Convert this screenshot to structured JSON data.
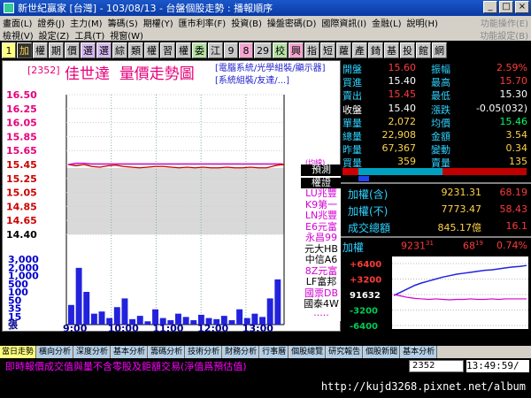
{
  "window": {
    "title": "新世紀贏家 [台灣] - 103/08/13 - 台盤個股走勢 : 播報順序",
    "min": "_",
    "max": "□",
    "close": "×"
  },
  "menu1": [
    "畫面(L)",
    "證券(J)",
    "主力(M)",
    "籌碼(S)",
    "期權(Y)",
    "匯市利率(F)",
    "投資(B)",
    "操盤密碼(D)",
    "國際資訊(I)",
    "金融(L)",
    "說明(H)",
    "功能操作(E)"
  ],
  "menu2": [
    "檢視(V)",
    "設定(Z)",
    "工具(T)",
    "視窗(W)",
    "功能設定(B)"
  ],
  "tabs": [
    "1",
    "加",
    "權",
    "期",
    "價",
    "選",
    "選",
    "綜",
    "類",
    "權",
    "習",
    "權",
    "委",
    "江",
    "9",
    "8",
    "29",
    "校",
    "興",
    "指",
    "短",
    "蘿",
    "產",
    "錡",
    "基",
    "投",
    "館",
    "網"
  ],
  "stock": {
    "code": "[2352]",
    "name": "佳世達",
    "chart_title": "量價走勢圖",
    "categories": [
      "[電腦系統/光學組裝/顯示器]",
      "[系統組裝/友達/...]"
    ]
  },
  "axis": {
    "price_labels": [
      "16.50",
      "16.25",
      "16.05",
      "15.85",
      "15.65",
      "15.45",
      "15.25",
      "15.05",
      "14.85",
      "14.65",
      "14.40"
    ],
    "volume_labels": [
      "3,000",
      "2,000",
      "1,000",
      "500",
      "100",
      "50",
      "35",
      "15",
      "張"
    ],
    "time_labels": [
      "9:00",
      "10:00",
      "11:00",
      "12:00",
      "13:00"
    ],
    "avg_label": "(均線)"
  },
  "legend": {
    "ticker": "預測",
    "header": "權證",
    "items": [
      {
        "text": "LU兆豐",
        "color": "#d400d4"
      },
      {
        "text": "K9第一",
        "color": "#d400d4"
      },
      {
        "text": "LN兆豐",
        "color": "#d400d4"
      },
      {
        "text": "E6元富",
        "color": "#d400d4"
      },
      {
        "text": "永昌99",
        "color": "#d400d4"
      },
      {
        "text": "元大HB",
        "color": "#000000"
      },
      {
        "text": "中信A6",
        "color": "#000000"
      },
      {
        "text": "8Z元富",
        "color": "#d400d4"
      },
      {
        "text": "LF富邦",
        "color": "#000000"
      },
      {
        "text": "國票DB",
        "color": "#d400d4"
      },
      {
        "text": "國泰4W",
        "color": "#000000"
      },
      {
        "text": "·····",
        "color": "#d400d4"
      }
    ]
  },
  "quote": {
    "left": [
      {
        "label": "開盤",
        "value": "15.60",
        "lc": "#2fd2ff",
        "vc": "#ff3b3b"
      },
      {
        "label": "買進",
        "value": "15.40",
        "lc": "#2fd2ff",
        "vc": "#ffffff"
      },
      {
        "label": "賣出",
        "value": "15.45",
        "lc": "#2fd2ff",
        "vc": "#ff3b3b"
      },
      {
        "label": "收盤",
        "value": "15.40",
        "lc": "#ffffff",
        "vc": "#ffffff"
      },
      {
        "label": "單量",
        "value": "2,072",
        "lc": "#2fd2ff",
        "vc": "#ffd24a"
      },
      {
        "label": "總量",
        "value": "22,908",
        "lc": "#2fd2ff",
        "vc": "#ffd24a"
      },
      {
        "label": "昨量",
        "value": "67,367",
        "lc": "#2fd2ff",
        "vc": "#ffd24a"
      },
      {
        "label": "買量",
        "value": "359",
        "lc": "#2fd2ff",
        "vc": "#ffd24a"
      }
    ],
    "right": [
      {
        "label": "振幅",
        "value": "2.59%",
        "lc": "#2fd2ff",
        "vc": "#ff3b3b"
      },
      {
        "label": "最高",
        "value": "15.70",
        "lc": "#2fd2ff",
        "vc": "#ff3b3b"
      },
      {
        "label": "最低",
        "value": "15.30",
        "lc": "#2fd2ff",
        "vc": "#ffffff"
      },
      {
        "label": "漲跌",
        "value": "-0.05(032)",
        "lc": "#2fd2ff",
        "vc": "#ffffff"
      },
      {
        "label": "均價",
        "value": "15.46",
        "lc": "#2fd2ff",
        "vc": "#00ff66"
      },
      {
        "label": "金額",
        "value": "3.54",
        "lc": "#2fd2ff",
        "vc": "#ffd24a"
      },
      {
        "label": "變動",
        "value": "0.34",
        "lc": "#2fd2ff",
        "vc": "#ffd24a"
      },
      {
        "label": "賣量",
        "value": "135",
        "lc": "#2fd2ff",
        "vc": "#ffd24a"
      }
    ]
  },
  "index": {
    "rows": [
      {
        "label": "加權(含)",
        "value": "9231.31",
        "change": "68.19"
      },
      {
        "label": "加權(不)",
        "value": "7773.47",
        "change": "58.43"
      },
      {
        "label": "成交總額",
        "value": "845.17億",
        "change": "16.1"
      }
    ],
    "mini": {
      "label": "加權",
      "value": "9231",
      "value_sup": "31",
      "change": "68",
      "change_sup": "19",
      "pct": "0.74%",
      "y_labels": [
        "+6400",
        "+3200",
        "91632",
        "-3200",
        "-6400"
      ]
    }
  },
  "bottom_tabs": [
    "當日走勢",
    "橫向分析",
    "深度分析",
    "基本分析",
    "籌碼分析",
    "技術分析",
    "財務分析",
    "行事曆",
    "個股總覽",
    "研究報告",
    "個股新聞",
    "基本分析"
  ],
  "status": {
    "text": "即時報價成交值與量不含零股及鉅額交易(淨值爲預估值)",
    "code_input": "2352",
    "clock": "13:49:59/"
  },
  "footer_url": "http://kujd3268.pixnet.net/album",
  "chart_data": {
    "type": "line",
    "title": "量價走勢圖",
    "x": [
      "9:00",
      "10:00",
      "11:00",
      "12:00",
      "13:00"
    ],
    "ylim": [
      14.4,
      16.5
    ],
    "series": [
      {
        "name": "price",
        "color": "#cc0000",
        "values": [
          15.45,
          15.43,
          15.45,
          15.42,
          15.41,
          15.43,
          15.44,
          15.42,
          15.41,
          15.4,
          15.41,
          15.42,
          15.42,
          15.41,
          15.4,
          15.41,
          15.4,
          15.41,
          15.4,
          15.4,
          15.41,
          15.4,
          15.4,
          15.41,
          15.4,
          15.4,
          15.43,
          15.45
        ]
      },
      {
        "name": "average",
        "color": "#d400d4",
        "values": [
          15.45,
          15.47,
          15.47,
          15.46,
          15.46,
          15.46,
          15.46,
          15.46,
          15.46,
          15.46,
          15.46,
          15.46,
          15.46,
          15.46,
          15.46,
          15.46,
          15.46,
          15.46,
          15.46,
          15.46,
          15.46,
          15.46,
          15.46,
          15.46,
          15.46,
          15.46,
          15.46,
          15.46
        ]
      }
    ],
    "volume": [
      900,
      2600,
      1500,
      500,
      600,
      300,
      800,
      1200,
      250,
      400,
      150,
      700,
      300,
      200,
      500,
      350,
      200,
      450,
      300,
      250,
      400,
      200,
      700,
      300,
      500,
      350,
      1200,
      2072
    ],
    "mini_index": {
      "index_line": [
        -200,
        500,
        1200,
        1900,
        2400,
        2800,
        3200,
        3600,
        3900,
        4200,
        4400,
        4600,
        4800,
        5000,
        5100,
        5300,
        5500,
        5700,
        5800,
        6000
      ],
      "ref_line": [
        0,
        -300,
        -600,
        -800,
        -900,
        -1000,
        -900,
        -1000,
        -1100,
        -1000,
        -1000,
        -900,
        -1000,
        -1000,
        -900,
        -1000,
        -900,
        -900,
        -900,
        -900
      ],
      "ylim": [
        -6400,
        6400
      ]
    }
  }
}
